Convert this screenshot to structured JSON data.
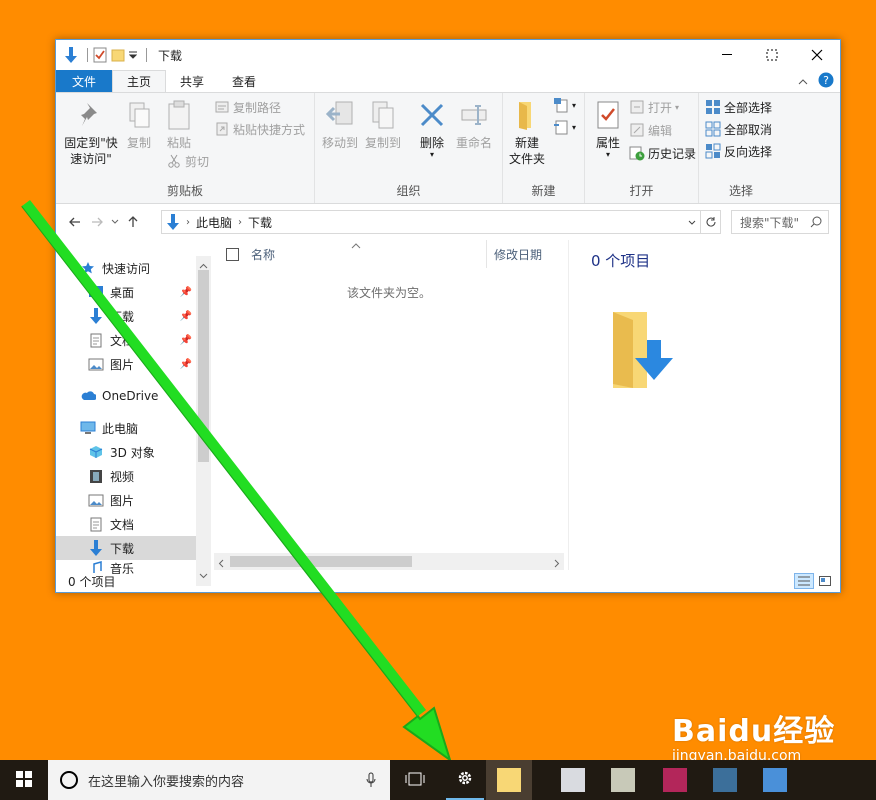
{
  "window": {
    "title": "下载",
    "tabs": [
      {
        "label": "文件"
      },
      {
        "label": "主页"
      },
      {
        "label": "共享"
      },
      {
        "label": "查看"
      }
    ]
  },
  "ribbon": {
    "clipboard": {
      "pin_label": "固定到\"快速访问\"",
      "copy_label": "复制",
      "paste_label": "粘贴",
      "copy_path_label": "复制路径",
      "paste_shortcut_label": "粘贴快捷方式",
      "cut_label": "剪切",
      "group_label": "剪贴板"
    },
    "organize": {
      "move_to_label": "移动到",
      "copy_to_label": "复制到",
      "delete_label": "删除",
      "rename_label": "重命名",
      "group_label": "组织"
    },
    "new": {
      "new_folder_label": "新建\n文件夹",
      "group_label": "新建"
    },
    "open": {
      "properties_label": "属性",
      "open_label": "打开",
      "edit_label": "编辑",
      "history_label": "历史记录",
      "group_label": "打开"
    },
    "select": {
      "select_all_label": "全部选择",
      "select_none_label": "全部取消",
      "invert_label": "反向选择",
      "group_label": "选择"
    }
  },
  "address": {
    "crumbs": [
      "此电脑",
      "下载"
    ],
    "search_placeholder": "搜索\"下载\""
  },
  "nav": {
    "items": [
      {
        "label": "快速访问"
      },
      {
        "label": "桌面"
      },
      {
        "label": "下载"
      },
      {
        "label": "文档"
      },
      {
        "label": "图片"
      },
      {
        "label": "OneDrive"
      },
      {
        "label": "此电脑"
      },
      {
        "label": "3D 对象"
      },
      {
        "label": "视频"
      },
      {
        "label": "图片"
      },
      {
        "label": "文档"
      },
      {
        "label": "下载"
      },
      {
        "label": "音乐"
      }
    ]
  },
  "files": {
    "col_name": "名称",
    "col_modified": "修改日期",
    "empty_text": "该文件夹为空。"
  },
  "preview": {
    "count_text": "0 个项目"
  },
  "status": {
    "text": "0 个项目"
  },
  "taskbar": {
    "search_placeholder": "在这里输入你要搜索的内容"
  },
  "watermark": {
    "brand": "Baidu经验",
    "url": "jingyan.baidu.com"
  },
  "colors": {
    "desktop": "#ff8c00",
    "arrow": "#22dd22",
    "file_tab": "#1979ca"
  }
}
